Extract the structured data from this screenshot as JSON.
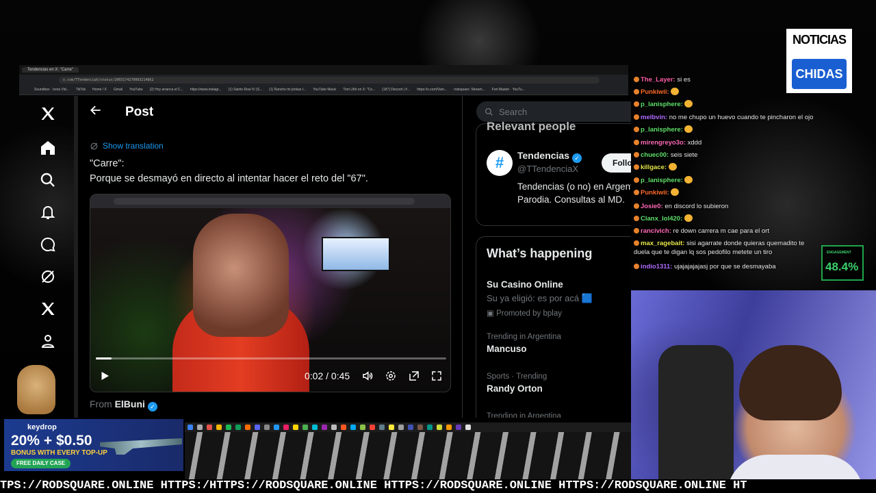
{
  "browser": {
    "tab_title": "Tendencias en X: \"Carre\"",
    "url": "x.com/TTendenciaX/status/2003174270003214862",
    "bookmarks": [
      "Soundbox · Isora Vid...",
      "TikTok",
      "Home / X",
      "Gmail",
      "YouTube",
      "(2) Hoy arranca el C...",
      "https://www.instagr...",
      "(1) Saints Row IV (S...",
      "(1) Rancho mi jonkas t...",
      "YouTube Music",
      "Tom Uhlr en X: \"Co...",
      "(187) Discord | #...",
      "https://x.com/Vam...",
      "rodsquare: Stream...",
      "Fort Master · YouTu..."
    ]
  },
  "nav": {
    "icons": [
      "x-logo-icon",
      "home-icon",
      "search-icon",
      "notifications-icon",
      "messages-icon",
      "grok-icon",
      "premium-x-icon",
      "profile-icon"
    ]
  },
  "post": {
    "title": "Post",
    "show_translation": "Show translation",
    "text_line1": "\"Carre\":",
    "text_line2": "Porque se desmayó en directo al intentar hacer el reto del \"67\".",
    "video": {
      "time": "0:02 / 0:45",
      "progress": 0.044
    },
    "from_label": "From",
    "from_name": "ElBuni"
  },
  "right": {
    "search_placeholder": "Search",
    "relevant_title": "Relevant people",
    "person": {
      "avatar": "#",
      "name": "Tendencias",
      "handle": "@TTendenciaX",
      "follow": "Follow",
      "bio": "Tendencias (o no) en Argentina. Parodia. Consultas al MD."
    },
    "whats_happening": "What’s happening",
    "trends": [
      {
        "meta": "",
        "name": "Su Casino Online",
        "desc": "Su ya eligió: es por acá 🟦",
        "promo": "Promoted by bplay"
      },
      {
        "meta": "Trending in Argentina",
        "name": "Mancuso"
      },
      {
        "meta": "Sports · Trending",
        "name": "Randy Orton"
      },
      {
        "meta": "Trending in Argentina",
        "name": ""
      }
    ]
  },
  "stream": {
    "logo_top": "NOTICIAS",
    "logo_bottom": "CHIDAS",
    "engagement_label": "ENGAGEMENT",
    "engagement_value": "48.4%",
    "chat": [
      {
        "user": "The_Layer",
        "color": "#ff5ea8",
        "msg": "si es"
      },
      {
        "user": "Punkiwii",
        "color": "#ff6a2a",
        "msg": ""
      },
      {
        "user": "p_lanisphere",
        "color": "#5fe06a",
        "msg": ""
      },
      {
        "user": "melbvin",
        "color": "#b06cff",
        "msg": "no me chupo un huevo cuando te pincharon el ojo"
      },
      {
        "user": "p_lanisphere",
        "color": "#5fe06a",
        "msg": ""
      },
      {
        "user": "mirengreyo3o",
        "color": "#ff6ab8",
        "msg": "xddd"
      },
      {
        "user": "chuec00",
        "color": "#5fe06a",
        "msg": "seis siete"
      },
      {
        "user": "killgace",
        "color": "#e6e64a",
        "msg": ""
      },
      {
        "user": "p_lanisphere",
        "color": "#5fe06a",
        "msg": ""
      },
      {
        "user": "Punkiwii",
        "color": "#ff6a2a",
        "msg": ""
      },
      {
        "user": "Josie0",
        "color": "#ff6ab8",
        "msg": "en discord lo subieron"
      },
      {
        "user": "Clanx_lol420",
        "color": "#5fe06a",
        "msg": ""
      },
      {
        "user": "rancivich",
        "color": "#ff6ab8",
        "msg": "re down carrera m cae para el ort"
      },
      {
        "user": "max_ragebait",
        "color": "#e6e64a",
        "msg": "sisi agarrate donde quieras quemadito te duela que te digan lq sos pedofilo metete un tiro"
      },
      {
        "user": "indio1311",
        "color": "#b06cff",
        "msg": "ujajajajajasj por que se desmayaba"
      }
    ],
    "ad": {
      "brand": "keydrop",
      "headline": "20% + $0.50",
      "sub": "BONUS WITH EVERY TOP-UP",
      "pill": "FREE DAILY CASE"
    },
    "ticker": "TPS://RODSQUARE.ONLINE HTTPS:/HTTPS://RODSQUARE.ONLINE HTTPS://RODSQUARE.ONLINE HTTPS://RODSQUARE.ONLINE HT"
  }
}
